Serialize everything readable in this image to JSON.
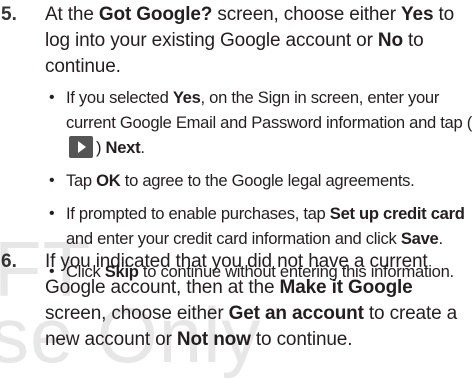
{
  "watermark": {
    "line1": "FT",
    "line2": "se Only"
  },
  "steps": [
    {
      "number": "5.",
      "t1": "At the ",
      "b1": "Got Google?",
      "t2": " screen, choose either ",
      "b2": "Yes",
      "t3": " to log into your existing Google account or ",
      "b3": "No",
      "t4": " to continue."
    },
    {
      "number": "6.",
      "t1": "If you indicated that you did not have a current Google account, then at the ",
      "b1": "Make it Google",
      "t2": " screen, choose either ",
      "b2": "Get an account",
      "t3": " to create a new account or ",
      "b3": "Not now",
      "t4": " to continue."
    }
  ],
  "bullets": [
    {
      "t1": "If you selected ",
      "b1": "Yes",
      "t2": ", on the Sign in screen, enter your current Google Email and Password information and tap (",
      "icon": "next-arrow-icon",
      "t3": ") ",
      "b2": "Next",
      "t4": "."
    },
    {
      "t1": "Tap ",
      "b1": "OK",
      "t2": " to agree to the Google legal agreements."
    },
    {
      "t1": "If prompted to enable purchases, tap ",
      "b1": "Set up credit card",
      "t2": " and enter your credit card information and click ",
      "b2": "Save",
      "t3": "."
    },
    {
      "t1": "Click ",
      "b1": "Skip",
      "t2": " to continue without entering this information."
    }
  ],
  "colors": {
    "text": "#231f20",
    "watermark": "#e7e7e7",
    "icon_bg": "#555555"
  }
}
